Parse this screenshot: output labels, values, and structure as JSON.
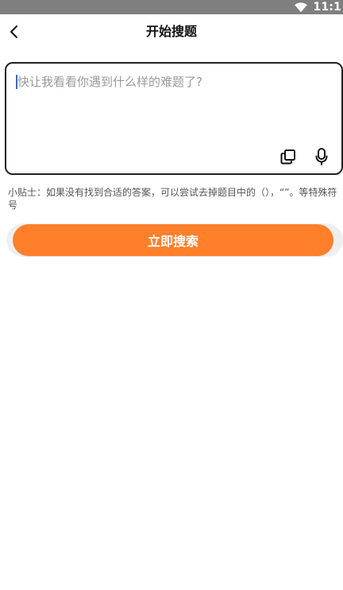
{
  "status_bar": {
    "time": "11:1",
    "wifi_icon": "wifi-icon",
    "background_color": "#7f7f7f"
  },
  "header": {
    "back_icon": "chevron-left-icon",
    "title": "开始搜题"
  },
  "input": {
    "value": "",
    "placeholder": "快让我看看你遇到什么样的难题了?",
    "actions": [
      {
        "icon": "copy-icon"
      },
      {
        "icon": "microphone-icon"
      }
    ]
  },
  "tip": {
    "text": "小贴士：如果没有找到合适的答案，可以尝试去掉题目中的（），“”。等特殊符号"
  },
  "search": {
    "label": "立即搜索",
    "color": "#ff7f2a"
  }
}
